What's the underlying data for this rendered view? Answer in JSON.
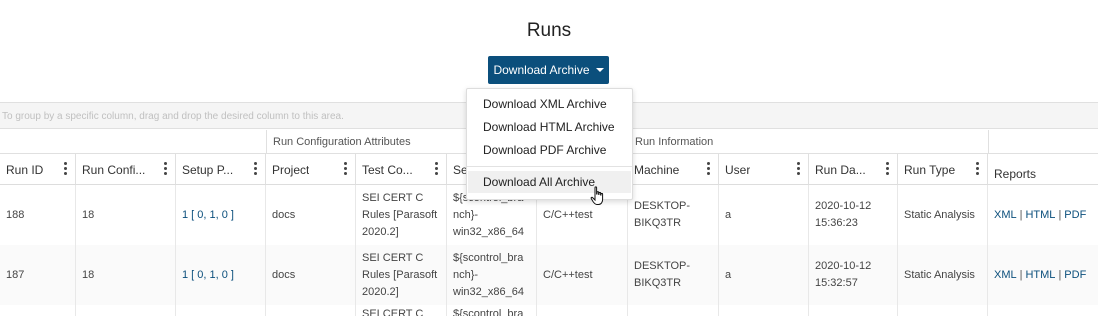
{
  "page": {
    "title": "Runs"
  },
  "toolbar": {
    "download_label": "Download Archive"
  },
  "download_menu": {
    "items": [
      "Download XML Archive",
      "Download HTML Archive",
      "Download PDF Archive"
    ],
    "all_item": "Download All Archive"
  },
  "grid": {
    "group_hint": "To group by a specific column, drag and drop the desired column to this area.",
    "group_headers": {
      "run_config": "Run Configuration Attributes",
      "run_info": "Run Information"
    },
    "columns": [
      "Run ID",
      "Run Confi...",
      "Setup P...",
      "Project",
      "Test Co...",
      "Se",
      "",
      "Machine",
      "User",
      "Run Da...",
      "Run Type",
      "Reports"
    ],
    "rows": [
      {
        "run_id": "188",
        "run_config": "18",
        "setup": "1 [ 0, 1, 0 ]",
        "project": "docs",
        "test_config": "SEI CERT C Rules [Parasoft 2020.2]",
        "session": "${scontrol_bra nch}-win32_x86_64",
        "tool": "C/C++test",
        "machine": "DESKTOP-BIKQ3TR",
        "user": "a",
        "run_date": "2020-10-12 15:36:23",
        "run_type": "Static Analysis",
        "reports": [
          "XML",
          "HTML",
          "PDF"
        ]
      },
      {
        "run_id": "187",
        "run_config": "18",
        "setup": "1 [ 0, 1, 0 ]",
        "project": "docs",
        "test_config": "SEI CERT C Rules [Parasoft 2020.2]",
        "session": "${scontrol_bra nch}-win32_x86_64",
        "tool": "C/C++test",
        "machine": "DESKTOP-BIKQ3TR",
        "user": "a",
        "run_date": "2020-10-12 15:32:57",
        "run_type": "Static Analysis",
        "reports": [
          "XML",
          "HTML",
          "PDF"
        ]
      },
      {
        "test_config": "SEI CERT C",
        "session": "${scontrol_bra"
      }
    ]
  },
  "colors": {
    "accent": "#0b4f7c",
    "link": "#0b4f7c"
  }
}
